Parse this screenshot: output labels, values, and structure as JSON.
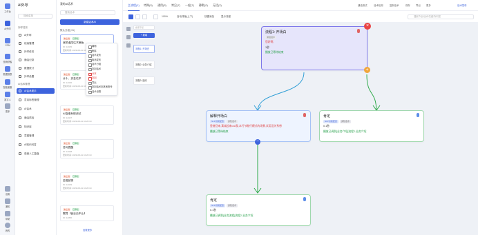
{
  "rail": {
    "items": [
      {
        "label": "工作台"
      },
      {
        "label": "AI外呼"
      },
      {
        "label": "CRM"
      },
      {
        "label": "营销获客"
      },
      {
        "label": "数据报表"
      },
      {
        "label": "智能客服"
      },
      {
        "label": "数字人"
      },
      {
        "label": "更多"
      }
    ],
    "bottom": [
      "设置",
      "通知",
      "帮助",
      "我的"
    ]
  },
  "sidebar": {
    "title": "AI外呼",
    "search_placeholder": "搜索菜单",
    "group1": "外呼任务",
    "group1_items": [
      "AI外呼",
      "线索管理",
      "外呼任务",
      "通话记录",
      "数据统计",
      "外呼设置"
    ],
    "group2": "AI话术管理",
    "group2_items": [
      "AI话术助手",
      "意向标签管理",
      "AI话术",
      "通话质检",
      "知识库",
      "意图管理",
      "AI知识问答",
      "语音人工复盘"
    ]
  },
  "listcol": {
    "top": "我的AI话术",
    "search_placeholder": "搜索话术",
    "new_button": "新建话术AI",
    "group": "默认分组 (31)",
    "cards": [
      {
        "tags": [
          "未上线",
          "已审核"
        ],
        "title": "营销通用话术模板",
        "meta1": "ID: 12345",
        "meta2": "更新时间: 2023-08-21 10:20:10"
      },
      {
        "tags": [
          "未上线",
          "已审核"
        ],
        "title": "开千、资金话术",
        "meta1": "ID: 12346",
        "meta2": "更新时间: 2023-08-21 10:20:10"
      },
      {
        "tags": [
          "未上线",
          "已审核"
        ],
        "title": "AI管理系统测试",
        "meta1": "ID: 12347",
        "meta2": "更新时间: 2023-08-21 10:20:10"
      },
      {
        "tags": [
          "未上线",
          "已审核"
        ],
        "title": "合同提醒",
        "meta1": "ID: 12348",
        "meta2": "更新时间: 2023-08-21 10:20:10"
      },
      {
        "tags": [
          "未上线",
          "已审核"
        ],
        "title": "金融营销",
        "meta1": "ID: 12349",
        "meta2": "更新时间: 2023-08-21 10:20:10"
      },
      {
        "tags": [
          "未上线",
          "已审核"
        ],
        "title": "教育【营业员中止】",
        "meta1": "ID: 12350",
        "meta2": "更新时间: 2023-08-21 10:20:10"
      }
    ],
    "footer": "加载更多",
    "context_menu": [
      "编辑",
      "删除",
      "话术发布",
      "取消发布",
      "话术分组",
      "复制话术",
      "分享",
      "复制",
      "导出",
      "复制话术到其他账号",
      "话术设置"
    ]
  },
  "topbar": {
    "tabs": [
      "主流程(1)",
      "特殊(0)",
      "通用(5)",
      "常见(7)",
      "一般(7)",
      "静默(0)",
      "无话(2)"
    ],
    "actions": [
      "通话测试",
      "话术检测",
      "复制话术",
      "保存",
      "导出",
      "更多",
      "话术发布"
    ]
  },
  "toolbar": {
    "zoom": "100%",
    "layout": "自动排版(上下)",
    "hint": "快捷添加",
    "show": "显示流程",
    "search_placeholder": "搜索节点/话术/关键词/问答"
  },
  "leftpanel": {
    "search_placeholder": "搜索节点",
    "new_button": "+ 新增",
    "items": [
      "流程1: 开场白",
      "流程2: 业务介绍",
      "流程3: 邀约"
    ]
  },
  "nodes": {
    "start": {
      "title": "流程1: 开场白",
      "tag": "通话话术",
      "lines": [
        "您好啊,",
        "1秒"
      ],
      "footer": "播放已等待结束"
    },
    "explain": {
      "title": "解释开场白",
      "tags": [
        "NLP识别配置",
        "通知话术"
      ],
      "line1": "靠谱回来,真诚起来call我,本行节能行模式的场景,试用没关系想",
      "footer": "播放已等待结束"
    },
    "confirm": {
      "title": "肯定",
      "tags": [
        "NLP识别配置",
        "通知话术"
      ],
      "line1": "0.1秒",
      "footer": "播放已调到[业务介绍]流程2-业务介绍"
    },
    "deny": {
      "title": "肯定",
      "tags": [
        "NLP识别配置",
        "通知话术"
      ],
      "line1": "0.1秒",
      "footer": "播放已调到[业务流程]流程2-业务介绍"
    }
  },
  "colors": {
    "accent": "#3d63dd",
    "edge_blue": "#2f9ed6",
    "edge_green": "#2faa4a"
  }
}
